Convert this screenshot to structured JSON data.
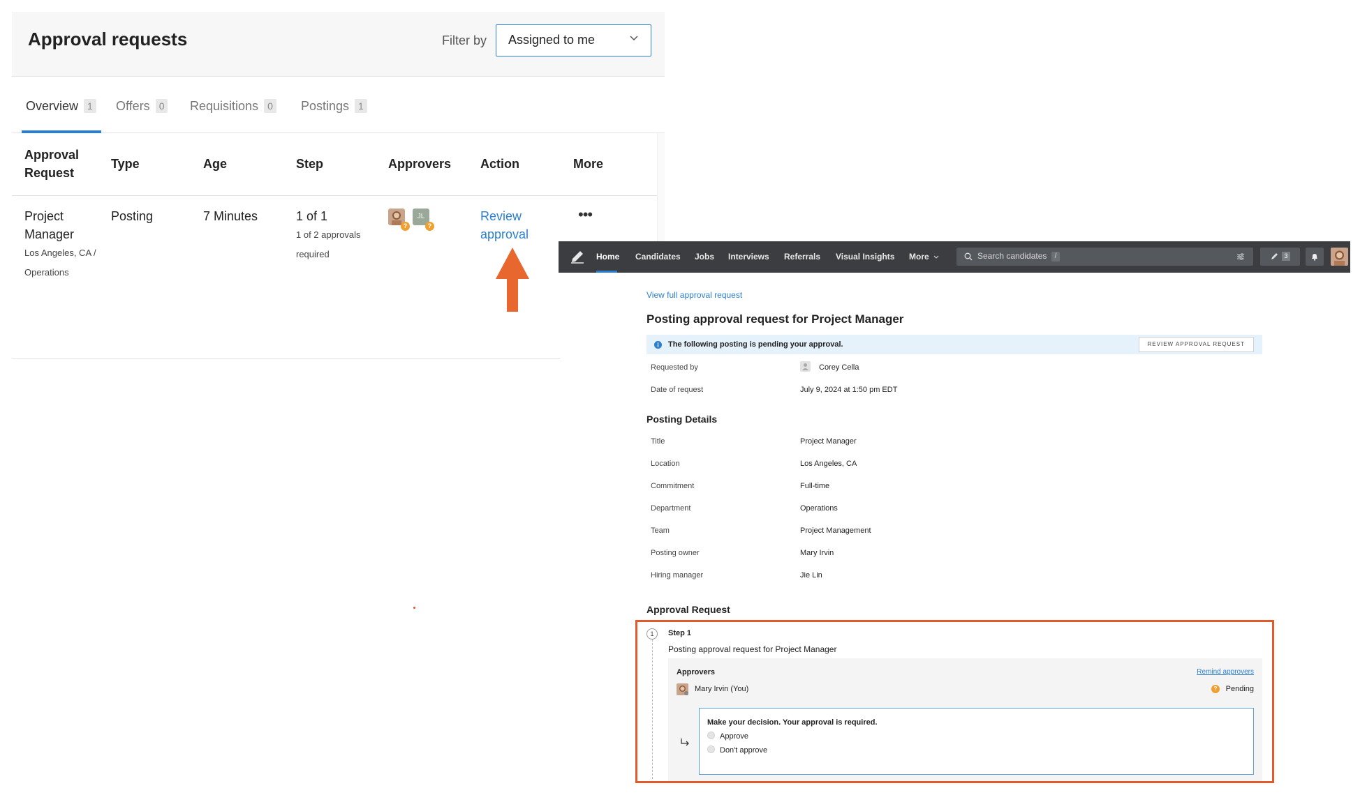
{
  "approvals_page": {
    "title": "Approval requests",
    "filter_label": "Filter by",
    "filter_value": "Assigned to me",
    "tabs": [
      {
        "label": "Overview",
        "count": "1"
      },
      {
        "label": "Offers",
        "count": "0"
      },
      {
        "label": "Requisitions",
        "count": "0"
      },
      {
        "label": "Postings",
        "count": "1"
      }
    ],
    "columns": {
      "request_line1": "Approval",
      "request_line2": "Request",
      "type": "Type",
      "age": "Age",
      "step": "Step",
      "approvers": "Approvers",
      "action": "Action",
      "more": "More"
    },
    "row": {
      "title_line1": "Project",
      "title_line2": "Manager",
      "location": "Los Angeles, CA /",
      "department": "Operations",
      "type": "Posting",
      "age": "7 Minutes",
      "step": "1 of 1",
      "step_sub_line1": "1 of 2 approvals",
      "step_sub_line2": "required",
      "approver_initials": "JL",
      "action_line1": "Review",
      "action_line2": "approval",
      "more_icon": "•••",
      "pending_mark": "?"
    }
  },
  "detail_page": {
    "nav": {
      "items": [
        "Home",
        "Candidates",
        "Jobs",
        "Interviews",
        "Referrals",
        "Visual Insights",
        "More"
      ],
      "search_placeholder": "Search candidates",
      "search_shortcut": "/",
      "drafts_count": "3"
    },
    "view_full_link": "View full approval request",
    "title": "Posting approval request for Project Manager",
    "banner_text": "The following posting is pending your approval.",
    "banner_button": "REVIEW APPROVAL REQUEST",
    "requested_by_label": "Requested by",
    "requested_by_value": "Corey Cella",
    "date_label": "Date of request",
    "date_value": "July 9, 2024 at 1:50 pm EDT",
    "posting_details_title": "Posting Details",
    "details": [
      {
        "label": "Title",
        "value": "Project Manager"
      },
      {
        "label": "Location",
        "value": "Los Angeles, CA"
      },
      {
        "label": "Commitment",
        "value": "Full-time"
      },
      {
        "label": "Department",
        "value": "Operations"
      },
      {
        "label": "Team",
        "value": "Project Management"
      },
      {
        "label": "Posting owner",
        "value": "Mary Irvin"
      },
      {
        "label": "Hiring manager",
        "value": "Jie Lin"
      }
    ],
    "approval_request_title": "Approval Request",
    "step": {
      "number": "1",
      "title": "Step 1",
      "description": "Posting approval request for Project Manager",
      "approvers_label": "Approvers",
      "remind_link": "Remind approvers",
      "approver_name": "Mary Irvin (You)",
      "status": "Pending",
      "status_mark": "?",
      "decision_title": "Make your decision. Your approval is required.",
      "option_approve": "Approve",
      "option_reject": "Don't approve"
    }
  },
  "colors": {
    "accent_blue": "#2b7fd1",
    "highlight_orange": "#e05a2b",
    "pending_orange": "#f0a030",
    "navbar": "#3b3d40"
  }
}
